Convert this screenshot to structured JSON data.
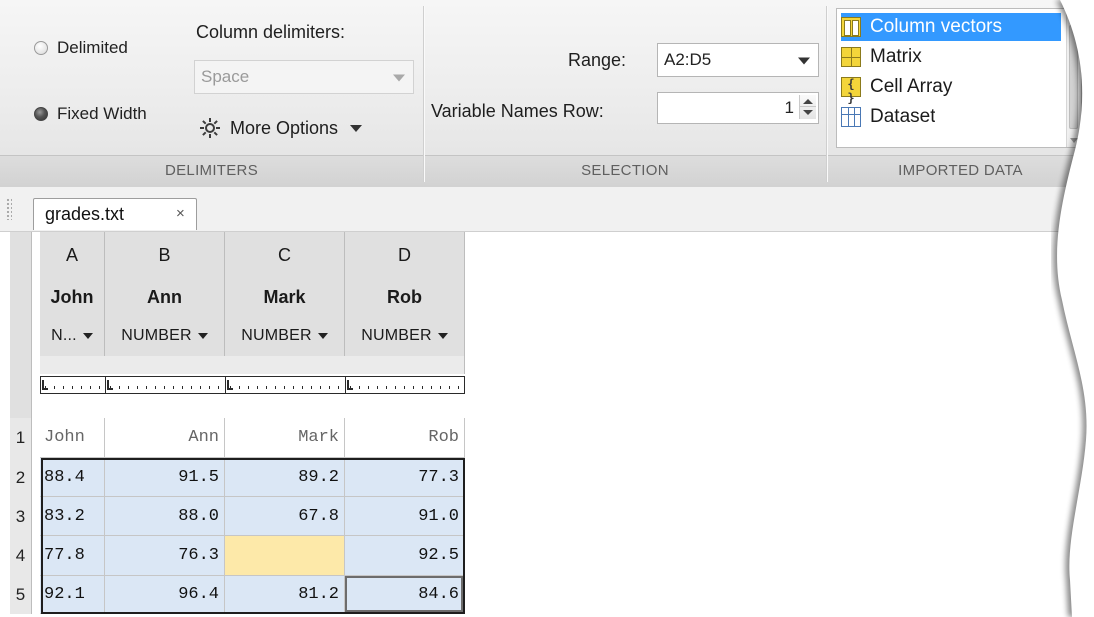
{
  "delimiters": {
    "section_label": "DELIMITERS",
    "delimited_label": "Delimited",
    "fixed_width_label": "Fixed Width",
    "column_delimiters_label": "Column delimiters:",
    "column_delimiter_value": "Space",
    "more_options_label": "More Options"
  },
  "selection": {
    "section_label": "SELECTION",
    "range_label": "Range:",
    "range_value": "A2:D5",
    "var_names_row_label": "Variable Names Row:",
    "var_names_row_value": "1"
  },
  "imported_data": {
    "section_label": "IMPORTED DATA",
    "options": [
      {
        "label": "Column vectors",
        "icon": "column-vectors-icon",
        "selected": true
      },
      {
        "label": "Matrix",
        "icon": "matrix-icon",
        "selected": false
      },
      {
        "label": "Cell Array",
        "icon": "cell-array-icon",
        "selected": false
      },
      {
        "label": "Dataset",
        "icon": "dataset-icon",
        "selected": false
      }
    ]
  },
  "document": {
    "tab_name": "grades.txt",
    "close_glyph": "×"
  },
  "grid": {
    "columns": [
      {
        "letter": "A",
        "var_name": "John",
        "type": "N..."
      },
      {
        "letter": "B",
        "var_name": "Ann",
        "type": "NUMBER"
      },
      {
        "letter": "C",
        "var_name": "Mark",
        "type": "NUMBER"
      },
      {
        "letter": "D",
        "var_name": "Rob",
        "type": "NUMBER"
      }
    ],
    "rows": [
      {
        "num": "1",
        "cells": [
          "John",
          "Ann",
          "Mark",
          "Rob"
        ]
      },
      {
        "num": "2",
        "cells": [
          "88.4",
          "91.5",
          "89.2",
          "77.3"
        ]
      },
      {
        "num": "3",
        "cells": [
          "83.2",
          "88.0",
          "67.8",
          "91.0"
        ]
      },
      {
        "num": "4",
        "cells": [
          "77.8",
          "76.3",
          "",
          "92.5"
        ]
      },
      {
        "num": "5",
        "cells": [
          "92.1",
          "96.4",
          "81.2",
          "84.6"
        ]
      }
    ]
  },
  "colors": {
    "selected_list_bg": "#3399ff",
    "data_cell_bg": "#dbe7f5",
    "missing_cell_bg": "#fde9a9"
  }
}
